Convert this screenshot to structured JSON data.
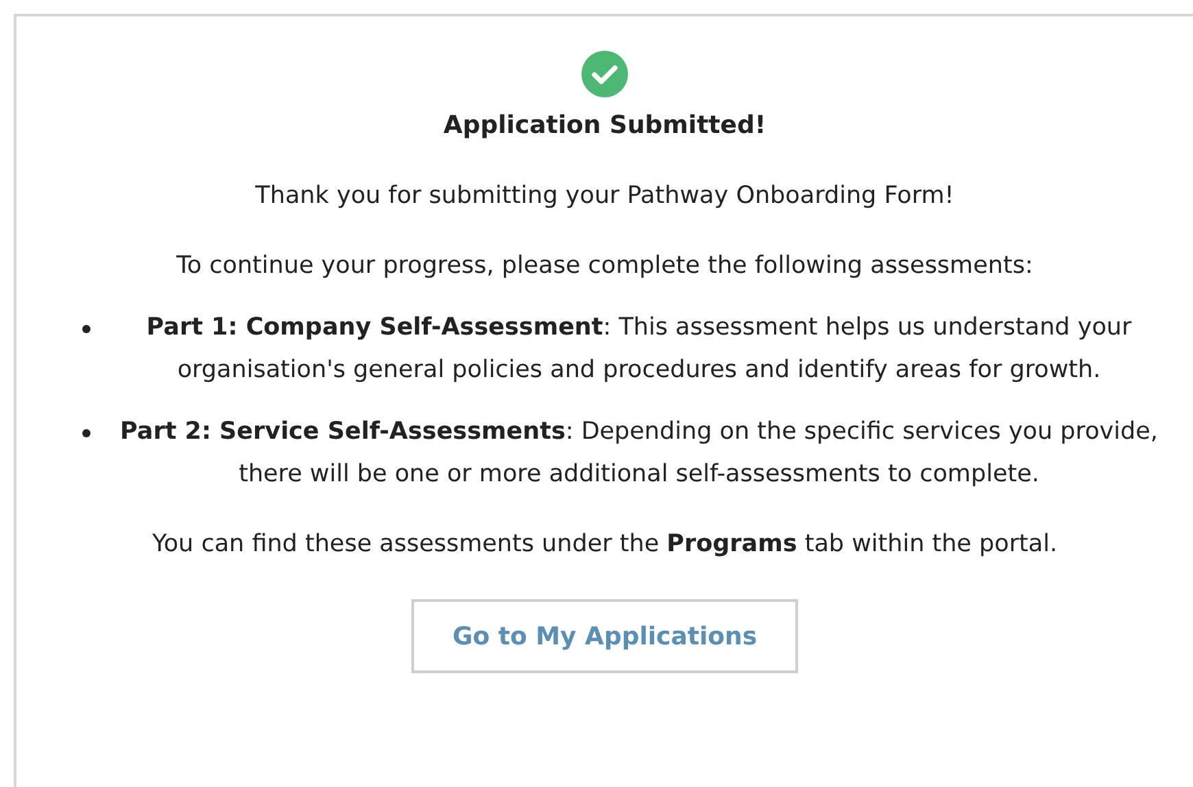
{
  "status": {
    "kind": "success",
    "title": "Application Submitted!"
  },
  "intro": "Thank you for submitting your Pathway Onboarding Form!",
  "lead": "To continue your progress, please complete the following assessments:",
  "assessments": [
    {
      "text": "**Part 1: Company Self-Assessment**: This assessment helps us understand your organisation's general policies and procedures and identify areas for growth."
    },
    {
      "text": "**Part 2: Service Self-Assessments**: Depending on the specific services you provide, there will be one or more additional self-assessments to complete."
    }
  ],
  "note": "You can find these assessments under the **Programs** tab within the portal.",
  "button": "Go to My Applications"
}
